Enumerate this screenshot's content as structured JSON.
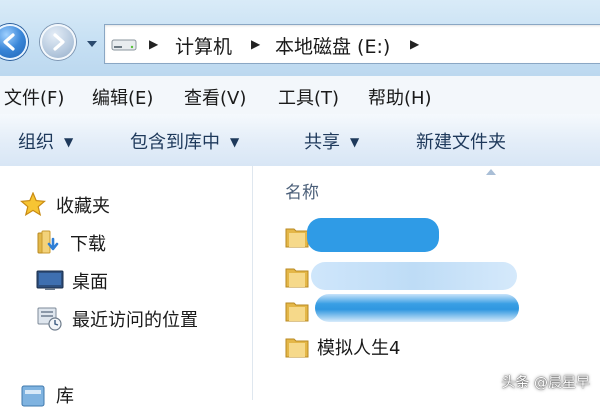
{
  "address_bar": {
    "crumbs": [
      "计算机",
      "本地磁盘 (E:)"
    ]
  },
  "menubar": {
    "items": [
      "文件(F)",
      "编辑(E)",
      "查看(V)",
      "工具(T)",
      "帮助(H)"
    ]
  },
  "toolbar": {
    "organize": "组织",
    "include_in_library": "包含到库中",
    "share": "共享",
    "new_folder": "新建文件夹"
  },
  "nav_pane": {
    "favorites": "收藏夹",
    "items": [
      "下载",
      "桌面",
      "最近访问的位置"
    ],
    "libraries": "库"
  },
  "content": {
    "column_name": "名称",
    "files": [
      "",
      "",
      "",
      "模拟人生4"
    ]
  },
  "watermark": "头条 @晨星早",
  "colors": {
    "toolbar_text": "#1e395b",
    "folder_yellow": "#f0c75a",
    "blur_blue": "#2f9be6"
  }
}
